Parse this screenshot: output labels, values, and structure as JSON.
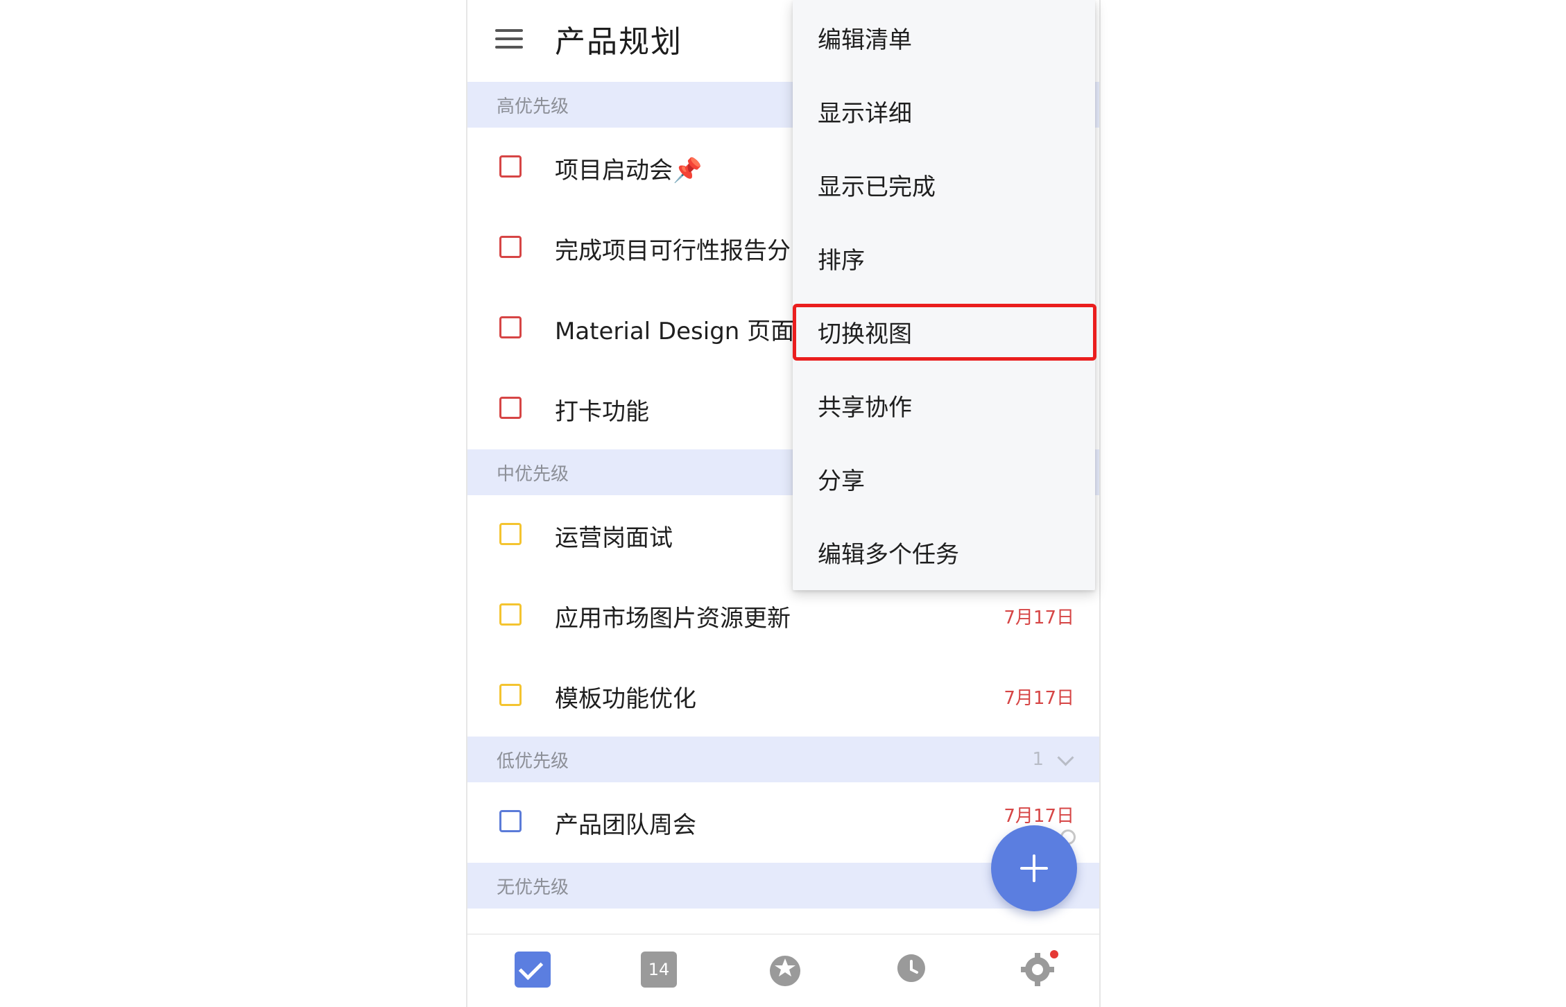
{
  "header": {
    "title": "产品规划"
  },
  "sections": [
    {
      "label": "高优先级"
    },
    {
      "label": "中优先级"
    },
    {
      "label": "低优先级",
      "count": "1"
    },
    {
      "label": "无优先级"
    }
  ],
  "tasks": {
    "high": [
      {
        "title": "项目启动会📌"
      },
      {
        "title": "完成项目可行性报告分"
      },
      {
        "title": "Material Design 页面优"
      },
      {
        "title": "打卡功能"
      }
    ],
    "medium": [
      {
        "title": "运营岗面试"
      },
      {
        "title": "应用市场图片资源更新",
        "date": "7月17日"
      },
      {
        "title": "模板功能优化",
        "date": "7月17日"
      }
    ],
    "low": [
      {
        "title": "产品团队周会",
        "date": "7月17日"
      }
    ]
  },
  "menu": {
    "items": [
      {
        "label": "编辑清单"
      },
      {
        "label": "显示详细"
      },
      {
        "label": "显示已完成"
      },
      {
        "label": "排序"
      },
      {
        "label": "切换视图",
        "highlighted": true
      },
      {
        "label": "共享协作"
      },
      {
        "label": "分享"
      },
      {
        "label": "编辑多个任务"
      }
    ]
  },
  "bottom_nav": {
    "items": [
      {
        "icon": "checkbox-icon",
        "active": true
      },
      {
        "icon": "calendar-icon",
        "text": "14"
      },
      {
        "icon": "habit-icon"
      },
      {
        "icon": "pomodoro-icon"
      },
      {
        "icon": "settings-icon",
        "badge": true
      }
    ]
  },
  "colors": {
    "accent": "#5b7ee0",
    "high_priority": "#d64545",
    "medium_priority": "#f4c430",
    "low_priority": "#5b7bd8",
    "section_bg": "#e5eafb",
    "highlight_border": "#ea1e1e"
  }
}
